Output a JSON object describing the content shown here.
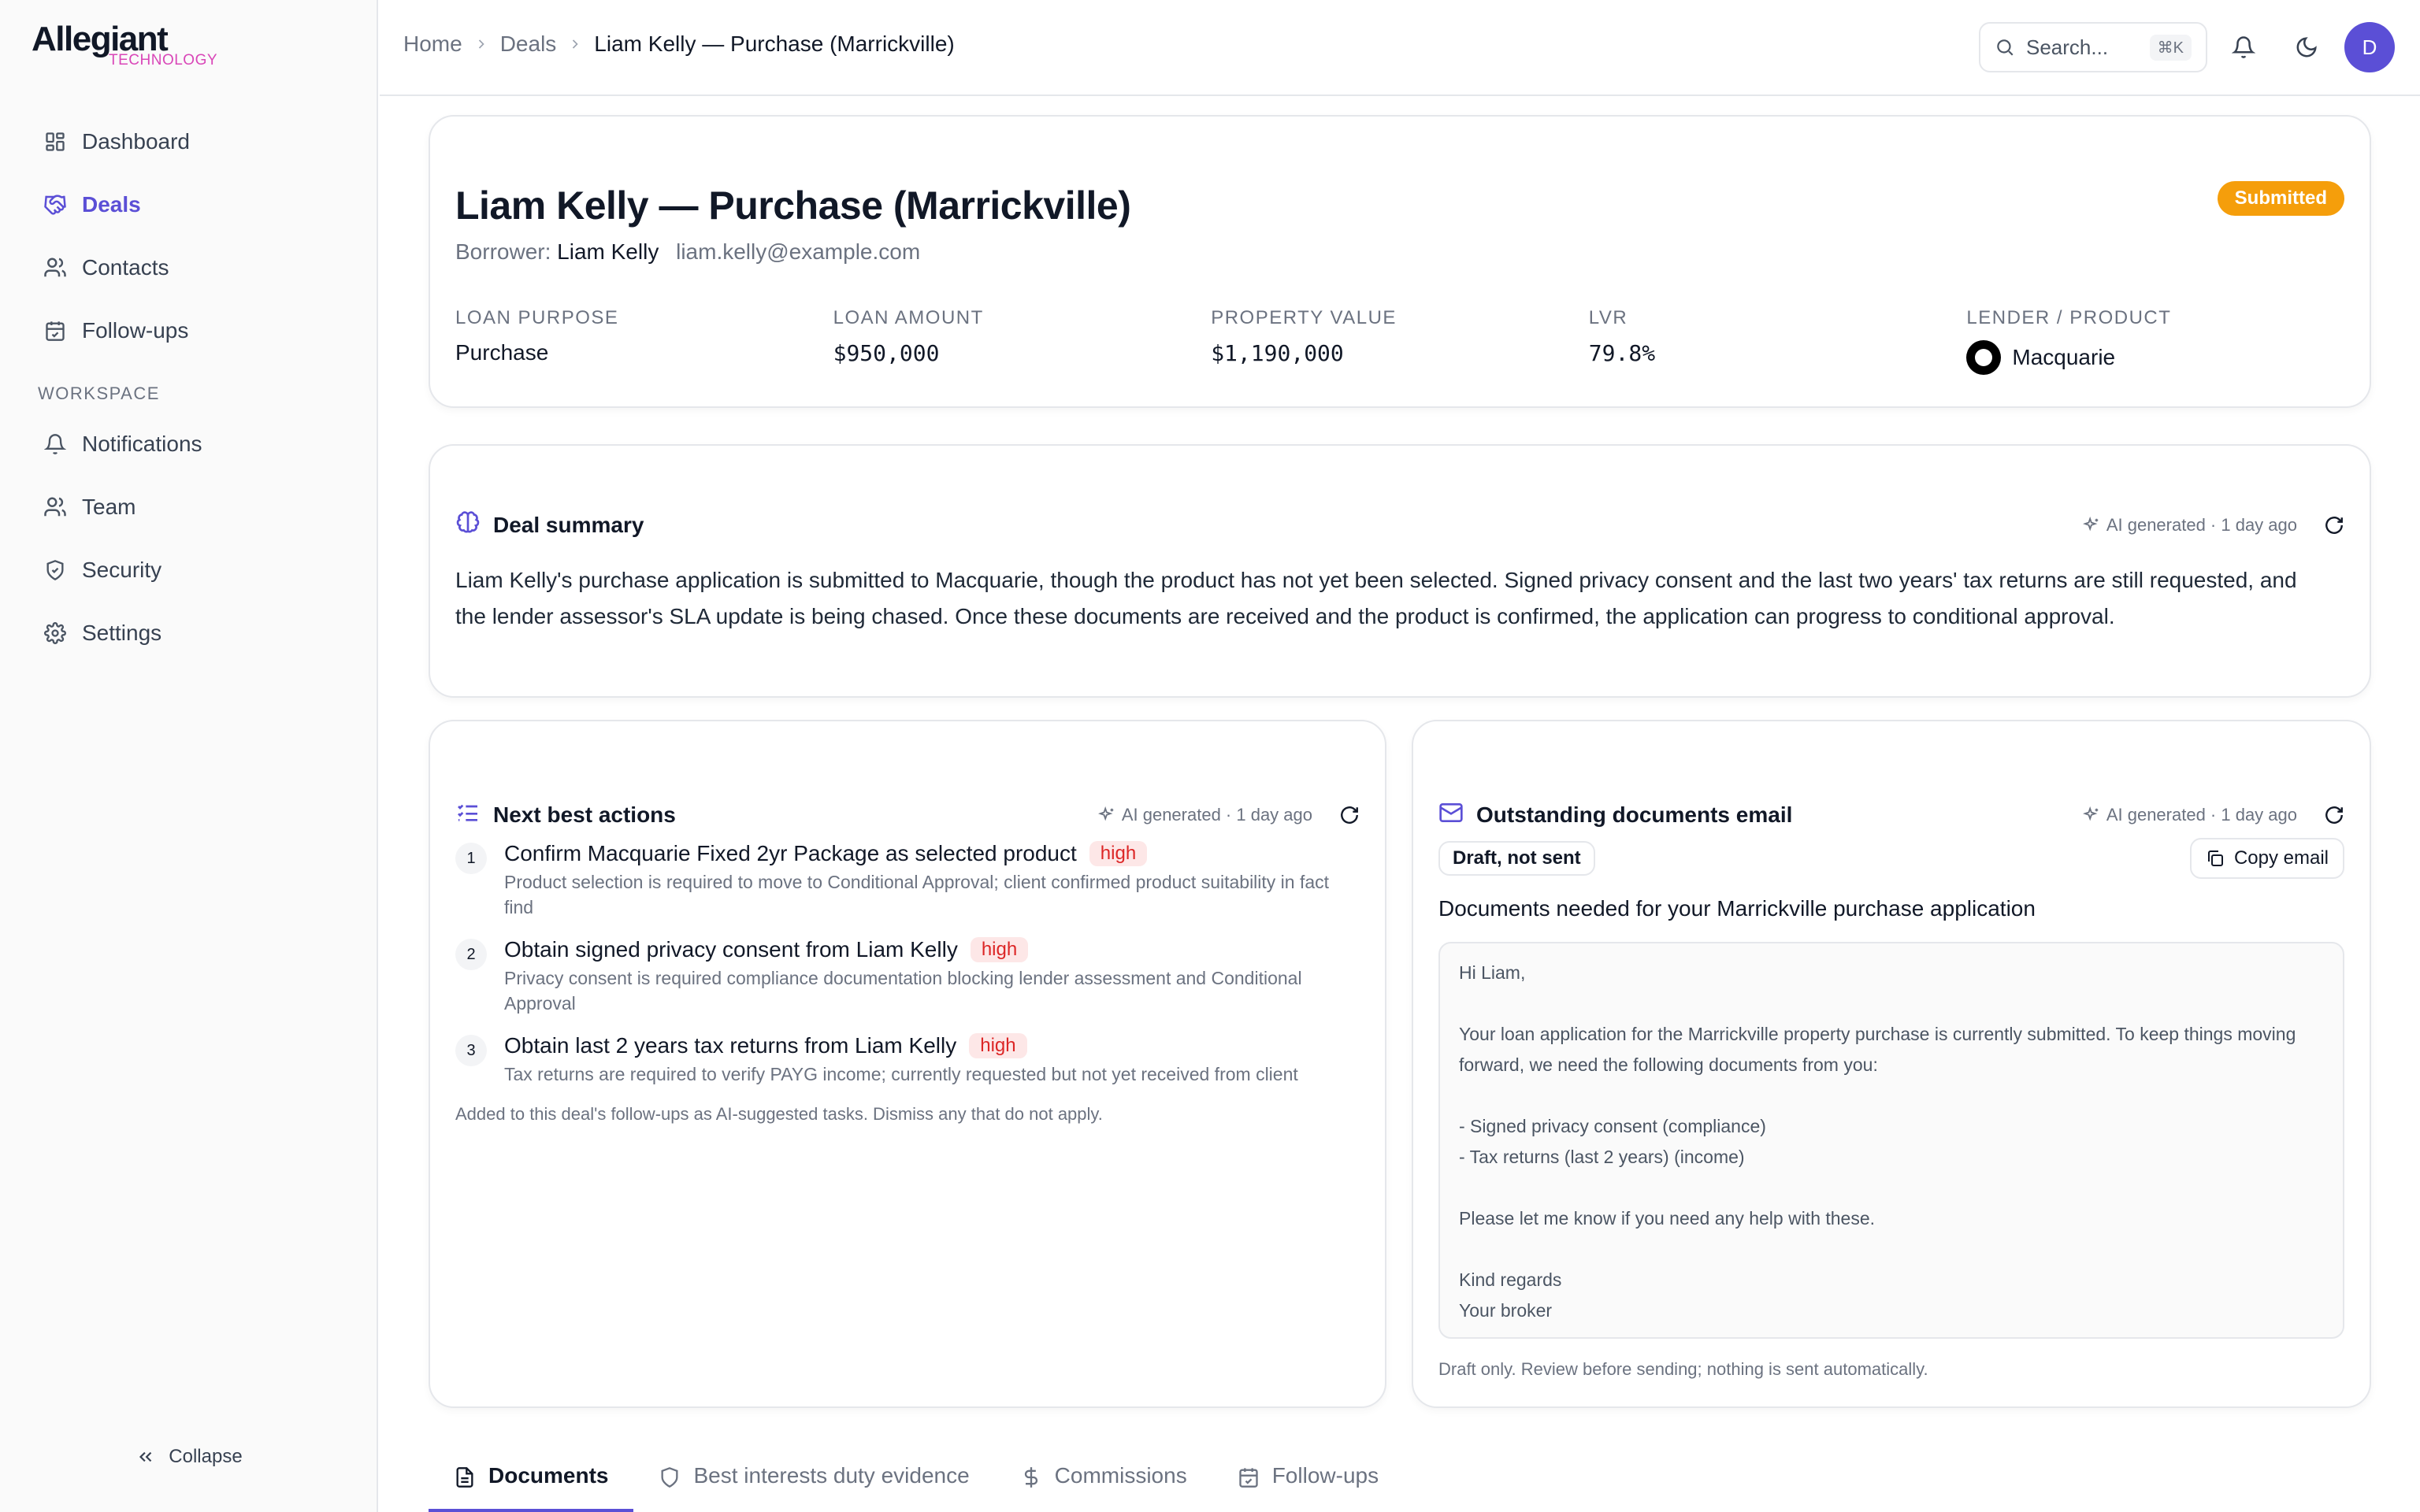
{
  "brand": {
    "name": "Allegiant",
    "sub": "TECHNOLOGY",
    "accent": "#5b4fd6",
    "sub_color": "#d946b8"
  },
  "sidebar": {
    "items": [
      {
        "label": "Dashboard",
        "icon": "grid-icon"
      },
      {
        "label": "Deals",
        "icon": "handshake-icon",
        "active": true
      },
      {
        "label": "Contacts",
        "icon": "users-icon"
      },
      {
        "label": "Follow-ups",
        "icon": "calendar-check-icon"
      }
    ],
    "section_label": "WORKSPACE",
    "workspace_items": [
      {
        "label": "Notifications",
        "icon": "bell-icon"
      },
      {
        "label": "Team",
        "icon": "users-icon"
      },
      {
        "label": "Security",
        "icon": "shield-icon"
      },
      {
        "label": "Settings",
        "icon": "gear-icon"
      }
    ],
    "collapse_label": "Collapse"
  },
  "header": {
    "breadcrumbs": [
      "Home",
      "Deals",
      "Liam Kelly — Purchase (Marrickville)"
    ],
    "search_placeholder": "Search...",
    "search_shortcut": "⌘K",
    "avatar_initial": "D"
  },
  "deal": {
    "title": "Liam Kelly — Purchase (Marrickville)",
    "borrower_label": "Borrower:",
    "borrower_name": "Liam Kelly",
    "borrower_email": "liam.kelly@example.com",
    "status": "Submitted",
    "status_color": "#f59e0b",
    "stats": [
      {
        "label": "LOAN PURPOSE",
        "value": "Purchase"
      },
      {
        "label": "LOAN AMOUNT",
        "value": "$950,000"
      },
      {
        "label": "PROPERTY VALUE",
        "value": "$1,190,000"
      },
      {
        "label": "LVR",
        "value": "79.8%"
      },
      {
        "label": "LENDER / PRODUCT",
        "value": "Macquarie"
      }
    ]
  },
  "summary": {
    "title": "Deal summary",
    "meta": "AI generated · 1 day ago",
    "text": "Liam Kelly's purchase application is submitted to Macquarie, though the product has not yet been selected. Signed privacy consent and the last two years' tax returns are still requested, and the lender assessor's SLA update is being chased. Once these documents are received and the product is confirmed, the application can progress to conditional approval."
  },
  "next_actions": {
    "title": "Next best actions",
    "meta": "AI generated · 1 day ago",
    "items": [
      {
        "num": "1",
        "title": "Confirm Macquarie Fixed 2yr Package as selected product",
        "priority": "high",
        "desc": "Product selection is required to move to Conditional Approval; client confirmed product suitability in fact find"
      },
      {
        "num": "2",
        "title": "Obtain signed privacy consent from Liam Kelly",
        "priority": "high",
        "desc": "Privacy consent is required compliance documentation blocking lender assessment and Conditional Approval"
      },
      {
        "num": "3",
        "title": "Obtain last 2 years tax returns from Liam Kelly",
        "priority": "high",
        "desc": "Tax returns are required to verify PAYG income; currently requested but not yet received from client"
      }
    ],
    "footnote": "Added to this deal's follow-ups as AI-suggested tasks. Dismiss any that do not apply."
  },
  "email": {
    "title": "Outstanding documents email",
    "meta": "AI generated · 1 day ago",
    "status": "Draft, not sent",
    "copy_label": "Copy email",
    "subject": "Documents needed for your Marrickville purchase application",
    "body": "Hi Liam,\n\nYour loan application for the Marrickville property purchase is currently submitted. To keep things moving forward, we need the following documents from you:\n\n- Signed privacy consent (compliance)\n- Tax returns (last 2 years) (income)\n\nPlease let me know if you need any help with these.\n\nKind regards\nYour broker",
    "footnote": "Draft only. Review before sending; nothing is sent automatically."
  },
  "tabs": [
    {
      "label": "Documents",
      "icon": "document-icon",
      "active": true
    },
    {
      "label": "Best interests duty evidence",
      "icon": "shield-icon"
    },
    {
      "label": "Commissions",
      "icon": "dollar-icon"
    },
    {
      "label": "Follow-ups",
      "icon": "calendar-check-icon"
    }
  ]
}
